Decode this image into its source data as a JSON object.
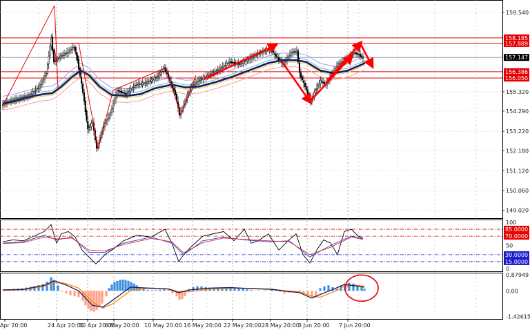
{
  "chart_data": [
    {
      "type": "candlestick",
      "panel": "price",
      "y_ticks": [
        "159.540",
        "158.185",
        "157.889",
        "157.147",
        "156.386",
        "156.050",
        "155.320",
        "154.290",
        "153.220",
        "152.180",
        "151.120",
        "150.060",
        "149.020"
      ],
      "ylim": [
        148.6,
        160.2
      ],
      "grid": true,
      "colors": {
        "bull": "#000000",
        "bear": "#000000",
        "current_tag_bg": "#000000",
        "level_tag_bg": "#e60000",
        "level_line": "#e60000",
        "trend_arrow": "#ff0000",
        "ma": "#1a1a66"
      },
      "levels": [
        {
          "value": 158.185,
          "label": "158.185"
        },
        {
          "value": 157.889,
          "label": "157.889"
        },
        {
          "value": 156.386,
          "label": "156.386"
        },
        {
          "value": 156.05,
          "label": "156.050"
        }
      ],
      "current_price": {
        "value": 157.147,
        "label": "157.147"
      },
      "moving_average": [
        [
          0,
          154.7
        ],
        [
          15,
          154.8
        ],
        [
          30,
          154.95
        ],
        [
          45,
          155.1
        ],
        [
          60,
          155.2
        ],
        [
          72,
          155.25
        ],
        [
          85,
          155.6
        ],
        [
          100,
          156.1
        ],
        [
          113,
          156.45
        ],
        [
          125,
          156.2
        ],
        [
          140,
          155.6
        ],
        [
          158,
          155.15
        ],
        [
          180,
          155.1
        ],
        [
          200,
          155.2
        ],
        [
          220,
          155.5
        ],
        [
          245,
          155.7
        ],
        [
          265,
          155.55
        ],
        [
          285,
          155.6
        ],
        [
          310,
          155.85
        ],
        [
          335,
          156.15
        ],
        [
          360,
          156.5
        ],
        [
          385,
          156.85
        ],
        [
          405,
          157.0
        ],
        [
          425,
          157.0
        ],
        [
          440,
          156.9
        ],
        [
          460,
          156.45
        ],
        [
          480,
          156.3
        ],
        [
          500,
          156.45
        ],
        [
          525,
          156.85
        ]
      ],
      "price_path": [
        [
          0,
          154.6
        ],
        [
          10,
          154.8
        ],
        [
          20,
          154.9
        ],
        [
          30,
          155.0
        ],
        [
          40,
          155.1
        ],
        [
          55,
          155.6
        ],
        [
          65,
          156.3
        ],
        [
          72,
          158.2
        ],
        [
          76,
          156.9
        ],
        [
          85,
          157.2
        ],
        [
          95,
          157.4
        ],
        [
          105,
          157.7
        ],
        [
          110,
          157.0
        ],
        [
          118,
          155.3
        ],
        [
          125,
          153.3
        ],
        [
          132,
          153.7
        ],
        [
          138,
          152.3
        ],
        [
          148,
          153.5
        ],
        [
          158,
          154.2
        ],
        [
          168,
          155.4
        ],
        [
          180,
          155.2
        ],
        [
          195,
          155.7
        ],
        [
          210,
          155.8
        ],
        [
          225,
          156.1
        ],
        [
          236,
          156.6
        ],
        [
          244,
          155.9
        ],
        [
          252,
          155.2
        ],
        [
          258,
          154.1
        ],
        [
          266,
          154.8
        ],
        [
          275,
          155.6
        ],
        [
          285,
          155.9
        ],
        [
          300,
          156.2
        ],
        [
          315,
          156.5
        ],
        [
          330,
          156.9
        ],
        [
          345,
          156.8
        ],
        [
          360,
          157.1
        ],
        [
          375,
          157.4
        ],
        [
          390,
          157.6
        ],
        [
          398,
          157.2
        ],
        [
          408,
          156.8
        ],
        [
          420,
          157.4
        ],
        [
          428,
          157.5
        ],
        [
          432,
          156.3
        ],
        [
          440,
          155.6
        ],
        [
          448,
          154.8
        ],
        [
          455,
          155.4
        ],
        [
          462,
          155.9
        ],
        [
          470,
          155.7
        ],
        [
          478,
          156.2
        ],
        [
          488,
          156.8
        ],
        [
          498,
          157.0
        ],
        [
          510,
          157.4
        ],
        [
          518,
          157.3
        ],
        [
          524,
          157.1
        ]
      ],
      "trend_lines": [
        [
          [
            0,
            154.6
          ],
          [
            75,
            159.9
          ]
        ],
        [
          [
            75,
            159.9
          ],
          [
            80,
            155.5
          ]
        ],
        [
          [
            75,
            157.6
          ],
          [
            78,
            156.9
          ]
        ],
        [
          [
            98,
            157.9
          ],
          [
            110,
            157.9
          ]
        ],
        [
          [
            110,
            157.9
          ],
          [
            138,
            152.3
          ]
        ],
        [
          [
            138,
            152.3
          ],
          [
            160,
            155.4
          ]
        ],
        [
          [
            160,
            155.4
          ],
          [
            236,
            156.6
          ]
        ],
        [
          [
            236,
            156.6
          ],
          [
            258,
            154.1
          ]
        ],
        [
          [
            258,
            154.1
          ],
          [
            280,
            156.2
          ]
        ]
      ],
      "arrows": [
        [
          [
            292,
            156.0
          ],
          [
            395,
            157.8
          ]
        ],
        [
          [
            405,
            156.9
          ],
          [
            445,
            154.8
          ]
        ],
        [
          [
            445,
            154.8
          ],
          [
            505,
            157.2
          ]
        ],
        [
          [
            470,
            155.9
          ],
          [
            518,
            157.9
          ]
        ],
        [
          [
            518,
            157.9
          ],
          [
            535,
            156.7
          ]
        ]
      ]
    },
    {
      "type": "line",
      "panel": "oscillator",
      "y_ticks": [
        "100",
        "85.0000",
        "70.0000",
        "50",
        "30.0000",
        "15.0000",
        "0"
      ],
      "ylim": [
        0,
        100
      ],
      "levels": [
        {
          "value": 85,
          "label": "85.0000",
          "color": "#e60000"
        },
        {
          "value": 70,
          "label": "70.0000",
          "color": "#e60000"
        },
        {
          "value": 30,
          "label": "30.0000",
          "color": "#1a1acc"
        },
        {
          "value": 15,
          "label": "15.0000",
          "color": "#1a1acc"
        }
      ],
      "series": [
        {
          "color": "#000000",
          "x": [
            0,
            15,
            30,
            45,
            60,
            70,
            78,
            85,
            95,
            105,
            115,
            125,
            135,
            148,
            160,
            175,
            195,
            215,
            235,
            245,
            255,
            262,
            275,
            290,
            305,
            320,
            335,
            350,
            360,
            370,
            385,
            400,
            415,
            425,
            435,
            445,
            455,
            465,
            475,
            485,
            495,
            505,
            515,
            522
          ],
          "values": [
            58,
            62,
            60,
            70,
            80,
            95,
            55,
            75,
            80,
            68,
            40,
            25,
            10,
            30,
            42,
            60,
            72,
            68,
            85,
            55,
            15,
            30,
            50,
            70,
            75,
            80,
            60,
            85,
            55,
            60,
            75,
            40,
            62,
            75,
            30,
            12,
            40,
            62,
            55,
            30,
            80,
            85,
            70,
            66
          ]
        },
        {
          "color": "#3333cc",
          "x": [
            0,
            30,
            60,
            78,
            100,
            125,
            148,
            175,
            215,
            245,
            262,
            290,
            320,
            350,
            385,
            415,
            445,
            475,
            505,
            522
          ],
          "values": [
            55,
            58,
            72,
            62,
            68,
            35,
            35,
            55,
            68,
            55,
            30,
            60,
            68,
            62,
            58,
            60,
            25,
            50,
            70,
            64
          ]
        },
        {
          "color": "#cc3333",
          "x": [
            0,
            30,
            60,
            78,
            100,
            125,
            148,
            175,
            215,
            245,
            262,
            290,
            320,
            350,
            385,
            415,
            445,
            475,
            505,
            522
          ],
          "values": [
            54,
            56,
            68,
            64,
            66,
            40,
            38,
            52,
            65,
            58,
            34,
            56,
            66,
            63,
            60,
            58,
            30,
            46,
            68,
            63
          ]
        }
      ]
    },
    {
      "type": "bar",
      "panel": "macd",
      "y_ticks": [
        "0.87949",
        "0.00",
        "-1.42615"
      ],
      "ylim": [
        -1.55,
        1.0
      ],
      "histogram": [
        [
          4,
          0.05
        ],
        [
          10,
          0.08
        ],
        [
          16,
          0.1
        ],
        [
          22,
          0.12
        ],
        [
          28,
          0.14
        ],
        [
          34,
          0.18
        ],
        [
          40,
          0.22
        ],
        [
          46,
          0.26
        ],
        [
          52,
          0.32
        ],
        [
          58,
          0.38
        ],
        [
          64,
          0.5
        ],
        [
          70,
          0.75
        ],
        [
          74,
          0.6
        ],
        [
          80,
          0.3
        ],
        [
          86,
          -0.05
        ],
        [
          92,
          -0.15
        ],
        [
          98,
          -0.25
        ],
        [
          104,
          -0.3
        ],
        [
          110,
          -0.35
        ],
        [
          116,
          -0.55
        ],
        [
          120,
          -0.8
        ],
        [
          124,
          -1.0
        ],
        [
          128,
          -1.1
        ],
        [
          132,
          -1.15
        ],
        [
          136,
          -1.05
        ],
        [
          140,
          -0.9
        ],
        [
          144,
          -0.7
        ],
        [
          150,
          -0.3
        ],
        [
          154,
          0.15
        ],
        [
          158,
          0.35
        ],
        [
          162,
          0.5
        ],
        [
          166,
          0.55
        ],
        [
          170,
          0.6
        ],
        [
          174,
          0.62
        ],
        [
          178,
          0.6
        ],
        [
          182,
          0.55
        ],
        [
          186,
          0.48
        ],
        [
          190,
          0.4
        ],
        [
          194,
          0.3
        ],
        [
          198,
          0.2
        ],
        [
          204,
          0.1
        ],
        [
          210,
          0.05
        ],
        [
          216,
          0.03
        ],
        [
          222,
          0.04
        ],
        [
          228,
          0.06
        ],
        [
          234,
          0.08
        ],
        [
          240,
          0.04
        ],
        [
          246,
          -0.15
        ],
        [
          252,
          -0.3
        ],
        [
          256,
          -0.5
        ],
        [
          260,
          -0.45
        ],
        [
          264,
          -0.3
        ],
        [
          270,
          0.1
        ],
        [
          276,
          0.2
        ],
        [
          282,
          0.25
        ],
        [
          288,
          0.25
        ],
        [
          294,
          0.2
        ],
        [
          300,
          0.15
        ],
        [
          306,
          0.15
        ],
        [
          312,
          0.12
        ],
        [
          318,
          0.1
        ],
        [
          324,
          0.12
        ],
        [
          330,
          0.14
        ],
        [
          336,
          0.15
        ],
        [
          342,
          0.14
        ],
        [
          348,
          0.12
        ],
        [
          354,
          0.08
        ],
        [
          360,
          0.04
        ],
        [
          370,
          0.02
        ],
        [
          380,
          0.02
        ],
        [
          390,
          0.1
        ],
        [
          396,
          0.08
        ],
        [
          402,
          -0.05
        ],
        [
          408,
          -0.15
        ],
        [
          414,
          -0.1
        ],
        [
          420,
          -0.02
        ],
        [
          430,
          0.02
        ],
        [
          436,
          -0.1
        ],
        [
          442,
          -0.25
        ],
        [
          448,
          -0.35
        ],
        [
          454,
          -0.3
        ],
        [
          460,
          0.15
        ],
        [
          466,
          0.25
        ],
        [
          472,
          0.3
        ],
        [
          478,
          0.2
        ],
        [
          484,
          0.1
        ],
        [
          490,
          0.3
        ],
        [
          496,
          0.4
        ],
        [
          502,
          0.45
        ],
        [
          508,
          0.4
        ],
        [
          514,
          0.3
        ],
        [
          520,
          0.2
        ],
        [
          524,
          0.12
        ]
      ],
      "signal_line": {
        "color": "#1a1a66",
        "x": [
          0,
          30,
          60,
          75,
          90,
          110,
          130,
          145,
          160,
          185,
          210,
          240,
          255,
          270,
          300,
          330,
          360,
          390,
          410,
          430,
          448,
          460,
          480,
          495,
          510,
          524
        ],
        "values": [
          0.05,
          0.08,
          0.3,
          0.55,
          0.35,
          0.0,
          -0.8,
          -0.9,
          -0.5,
          0.2,
          0.15,
          0.1,
          -0.1,
          0.05,
          0.15,
          0.18,
          0.12,
          0.08,
          -0.02,
          -0.1,
          -0.4,
          -0.2,
          0.1,
          0.35,
          0.28,
          0.2
        ]
      },
      "macd_line": {
        "color": "#ff8800",
        "x": [
          0,
          30,
          60,
          75,
          90,
          110,
          130,
          145,
          160,
          185,
          210,
          240,
          255,
          270,
          300,
          330,
          360,
          390,
          410,
          430,
          448,
          460,
          480,
          495,
          510,
          524
        ],
        "values": [
          0.02,
          0.06,
          0.25,
          0.45,
          0.42,
          0.15,
          -0.6,
          -0.95,
          -0.7,
          0.0,
          0.15,
          0.12,
          -0.05,
          -0.05,
          0.1,
          0.15,
          0.14,
          0.1,
          0.0,
          -0.05,
          -0.3,
          -0.35,
          -0.05,
          0.25,
          0.32,
          0.25
        ]
      },
      "highlight_circle": {
        "x": 520,
        "y": 0.15
      }
    }
  ],
  "time_axis": {
    "labels": [
      "Apr 20:00",
      "24 Apr 20:00",
      "30 Apr 20:00",
      "6 May 20:00",
      "10 May 20:00",
      "16 May 20:00",
      "22 May 20:00",
      "28 May 20:00",
      "3 Jun 20:00",
      "7 Jun 20:00"
    ],
    "x": [
      0,
      75,
      120,
      158,
      215,
      272,
      330,
      385,
      438,
      497
    ]
  }
}
